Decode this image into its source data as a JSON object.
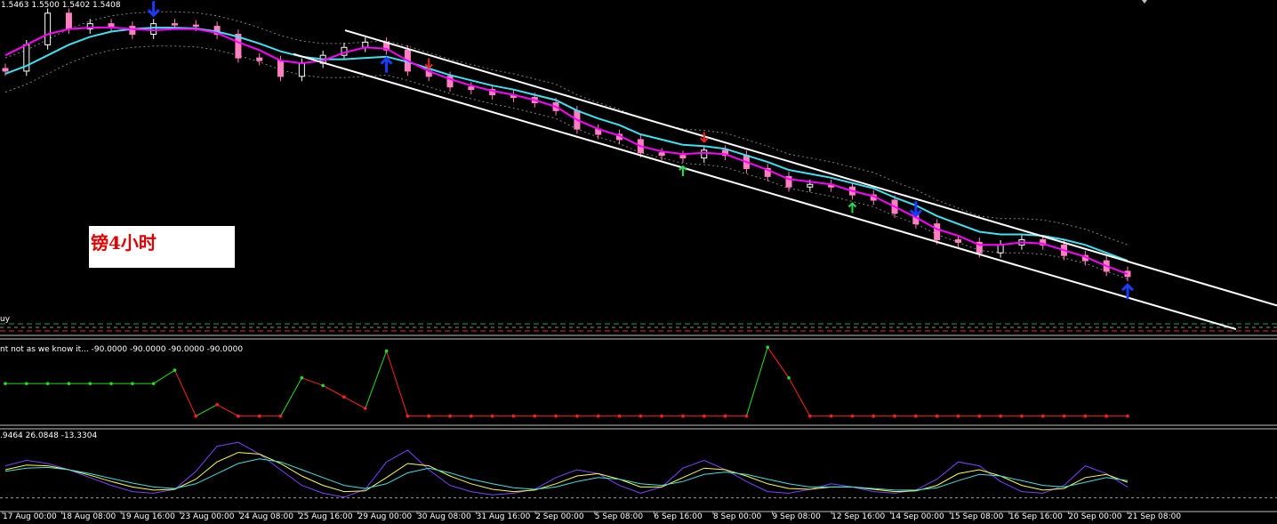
{
  "main_header": "1.5463 1.5500 1.5402 1.5408",
  "annotation": "镑4小时",
  "ind1_header": "nt not as we know it... -90.0000 -90.0000 -90.0000 -90.0000",
  "ind2_header": ".9464 26.0848 -13.3304",
  "ind_left_fragment": "uy",
  "colors": {
    "background": "#000000",
    "candle_up": "#ffffff",
    "candle_down": "#ff80c0",
    "ma_fast": "#ff00ff",
    "ma_slow": "#40e0f0",
    "channel": "#ffffff",
    "arrow_blue": "#1a3cff",
    "arrow_red": "#ff2020",
    "arrow_green": "#20e050",
    "ind1_low": "#ff2020",
    "ind1_high": "#20e020"
  },
  "chart_data": [
    {
      "type": "candlestick",
      "series": [
        {
          "name": "close",
          "values": [
            1.53,
            1.54,
            1.552,
            1.546,
            1.548,
            1.547,
            1.544,
            1.548,
            1.5475,
            1.547,
            1.544,
            1.535,
            1.534,
            1.528,
            1.533,
            1.536,
            1.539,
            1.541,
            1.538,
            1.53,
            1.528,
            1.524,
            1.523,
            1.521,
            1.52,
            1.518,
            1.515,
            1.508,
            1.506,
            1.504,
            1.499,
            1.498,
            1.497,
            1.5,
            1.498,
            1.493,
            1.49,
            1.486,
            1.487,
            1.486,
            1.483,
            1.481,
            1.476,
            1.472,
            1.466,
            1.465,
            1.461,
            1.464,
            1.466,
            1.464,
            1.46,
            1.458,
            1.454,
            1.452
          ]
        },
        {
          "name": "ma_fast",
          "values": [
            1.536,
            1.54,
            1.544,
            1.546,
            1.5465,
            1.5466,
            1.546,
            1.5455,
            1.546,
            1.546,
            1.5445,
            1.541,
            1.538,
            1.534,
            1.533,
            1.534,
            1.537,
            1.539,
            1.5385,
            1.534,
            1.53,
            1.527,
            1.5245,
            1.5225,
            1.521,
            1.519,
            1.5165,
            1.5115,
            1.508,
            1.5055,
            1.5015,
            1.4995,
            1.4985,
            1.499,
            1.4985,
            1.4955,
            1.4925,
            1.489,
            1.488,
            1.487,
            1.4845,
            1.4825,
            1.4785,
            1.4745,
            1.47,
            1.4675,
            1.464,
            1.464,
            1.465,
            1.4645,
            1.462,
            1.4595,
            1.456,
            1.453
          ]
        },
        {
          "name": "ma_slow",
          "values": [
            1.529,
            1.532,
            1.536,
            1.54,
            1.543,
            1.545,
            1.546,
            1.5465,
            1.5465,
            1.5462,
            1.545,
            1.543,
            1.5405,
            1.5375,
            1.5355,
            1.5345,
            1.5345,
            1.535,
            1.5355,
            1.5335,
            1.531,
            1.5285,
            1.5265,
            1.5245,
            1.523,
            1.521,
            1.519,
            1.515,
            1.512,
            1.5095,
            1.506,
            1.504,
            1.502,
            1.5015,
            1.5005,
            1.498,
            1.4955,
            1.4925,
            1.491,
            1.4895,
            1.4875,
            1.4855,
            1.482,
            1.479,
            1.475,
            1.472,
            1.469,
            1.468,
            1.468,
            1.4675,
            1.466,
            1.464,
            1.461,
            1.458
          ]
        }
      ],
      "channel": {
        "upper": [
          1.5455,
          1.441
        ],
        "lower": [
          1.5365,
          1.432
        ]
      }
    },
    {
      "type": "line",
      "values": [
        -5,
        -5,
        -5,
        -5,
        -5,
        -5,
        -5,
        -5,
        30,
        -90,
        -60,
        -90,
        -90,
        -90,
        10,
        -10,
        -40,
        -70,
        80,
        -90,
        -90,
        -90,
        -90,
        -90,
        -90,
        -90,
        -90,
        -90,
        -90,
        -90,
        -90,
        -90,
        -90,
        -90,
        -90,
        -90,
        90,
        10,
        -90,
        -90,
        -90,
        -90,
        -90,
        -90,
        -90,
        -90,
        -90,
        -90,
        -90,
        -90,
        -90,
        -90,
        -90,
        -90
      ],
      "ylim": [
        -100,
        100
      ]
    },
    {
      "type": "line",
      "series": [
        {
          "name": "main",
          "values": [
            55,
            62,
            58,
            50,
            40,
            30,
            22,
            20,
            25,
            48,
            80,
            85,
            70,
            50,
            30,
            20,
            15,
            25,
            60,
            75,
            50,
            30,
            22,
            18,
            20,
            25,
            40,
            50,
            45,
            30,
            20,
            28,
            52,
            62,
            50,
            35,
            22,
            20,
            25,
            32,
            28,
            22,
            20,
            24,
            38,
            60,
            55,
            35,
            22,
            20,
            30,
            55,
            45,
            28
          ]
        },
        {
          "name": "signal",
          "values": [
            50,
            56,
            55,
            50,
            43,
            35,
            28,
            24,
            25,
            38,
            60,
            72,
            70,
            58,
            42,
            30,
            22,
            23,
            40,
            58,
            55,
            42,
            32,
            25,
            22,
            24,
            32,
            42,
            45,
            38,
            28,
            28,
            40,
            52,
            50,
            42,
            32,
            26,
            25,
            28,
            28,
            25,
            22,
            23,
            30,
            45,
            50,
            42,
            30,
            24,
            26,
            40,
            44,
            34
          ]
        },
        {
          "name": "third",
          "values": [
            48,
            52,
            53,
            50,
            45,
            39,
            33,
            28,
            26,
            32,
            45,
            58,
            64,
            60,
            50,
            40,
            30,
            26,
            32,
            46,
            52,
            46,
            38,
            32,
            27,
            25,
            28,
            35,
            40,
            38,
            32,
            30,
            35,
            44,
            47,
            44,
            38,
            32,
            28,
            28,
            28,
            26,
            24,
            24,
            27,
            36,
            44,
            42,
            36,
            30,
            28,
            34,
            40,
            36
          ]
        }
      ],
      "ylim": [
        0,
        100
      ]
    }
  ],
  "x_tick_labels": [
    "17 Aug 00:00",
    "18 Aug 08:00",
    "19 Aug 16:00",
    "23 Aug 00:00",
    "24 Aug 08:00",
    "25 Aug 16:00",
    "29 Aug 00:00",
    "30 Aug 08:00",
    "31 Aug 16:00",
    "2 Sep 00:00",
    "5 Sep 08:00",
    "6 Sep 16:00",
    "8 Sep 00:00",
    "9 Sep 08:00",
    "12 Sep 16:00",
    "14 Sep 00:00",
    "15 Sep 08:00",
    "16 Sep 16:00",
    "20 Sep 00:00",
    "21 Sep 08:00"
  ],
  "signals": [
    {
      "kind": "down",
      "color": "blue",
      "index": 7
    },
    {
      "kind": "up",
      "color": "blue",
      "index": 18
    },
    {
      "kind": "down",
      "color": "red",
      "index": 20
    },
    {
      "kind": "down",
      "color": "red",
      "index": 33
    },
    {
      "kind": "up",
      "color": "green",
      "index": 32
    },
    {
      "kind": "up",
      "color": "green",
      "index": 40
    },
    {
      "kind": "down",
      "color": "blue",
      "index": 43
    },
    {
      "kind": "up",
      "color": "blue",
      "index": 53
    }
  ]
}
